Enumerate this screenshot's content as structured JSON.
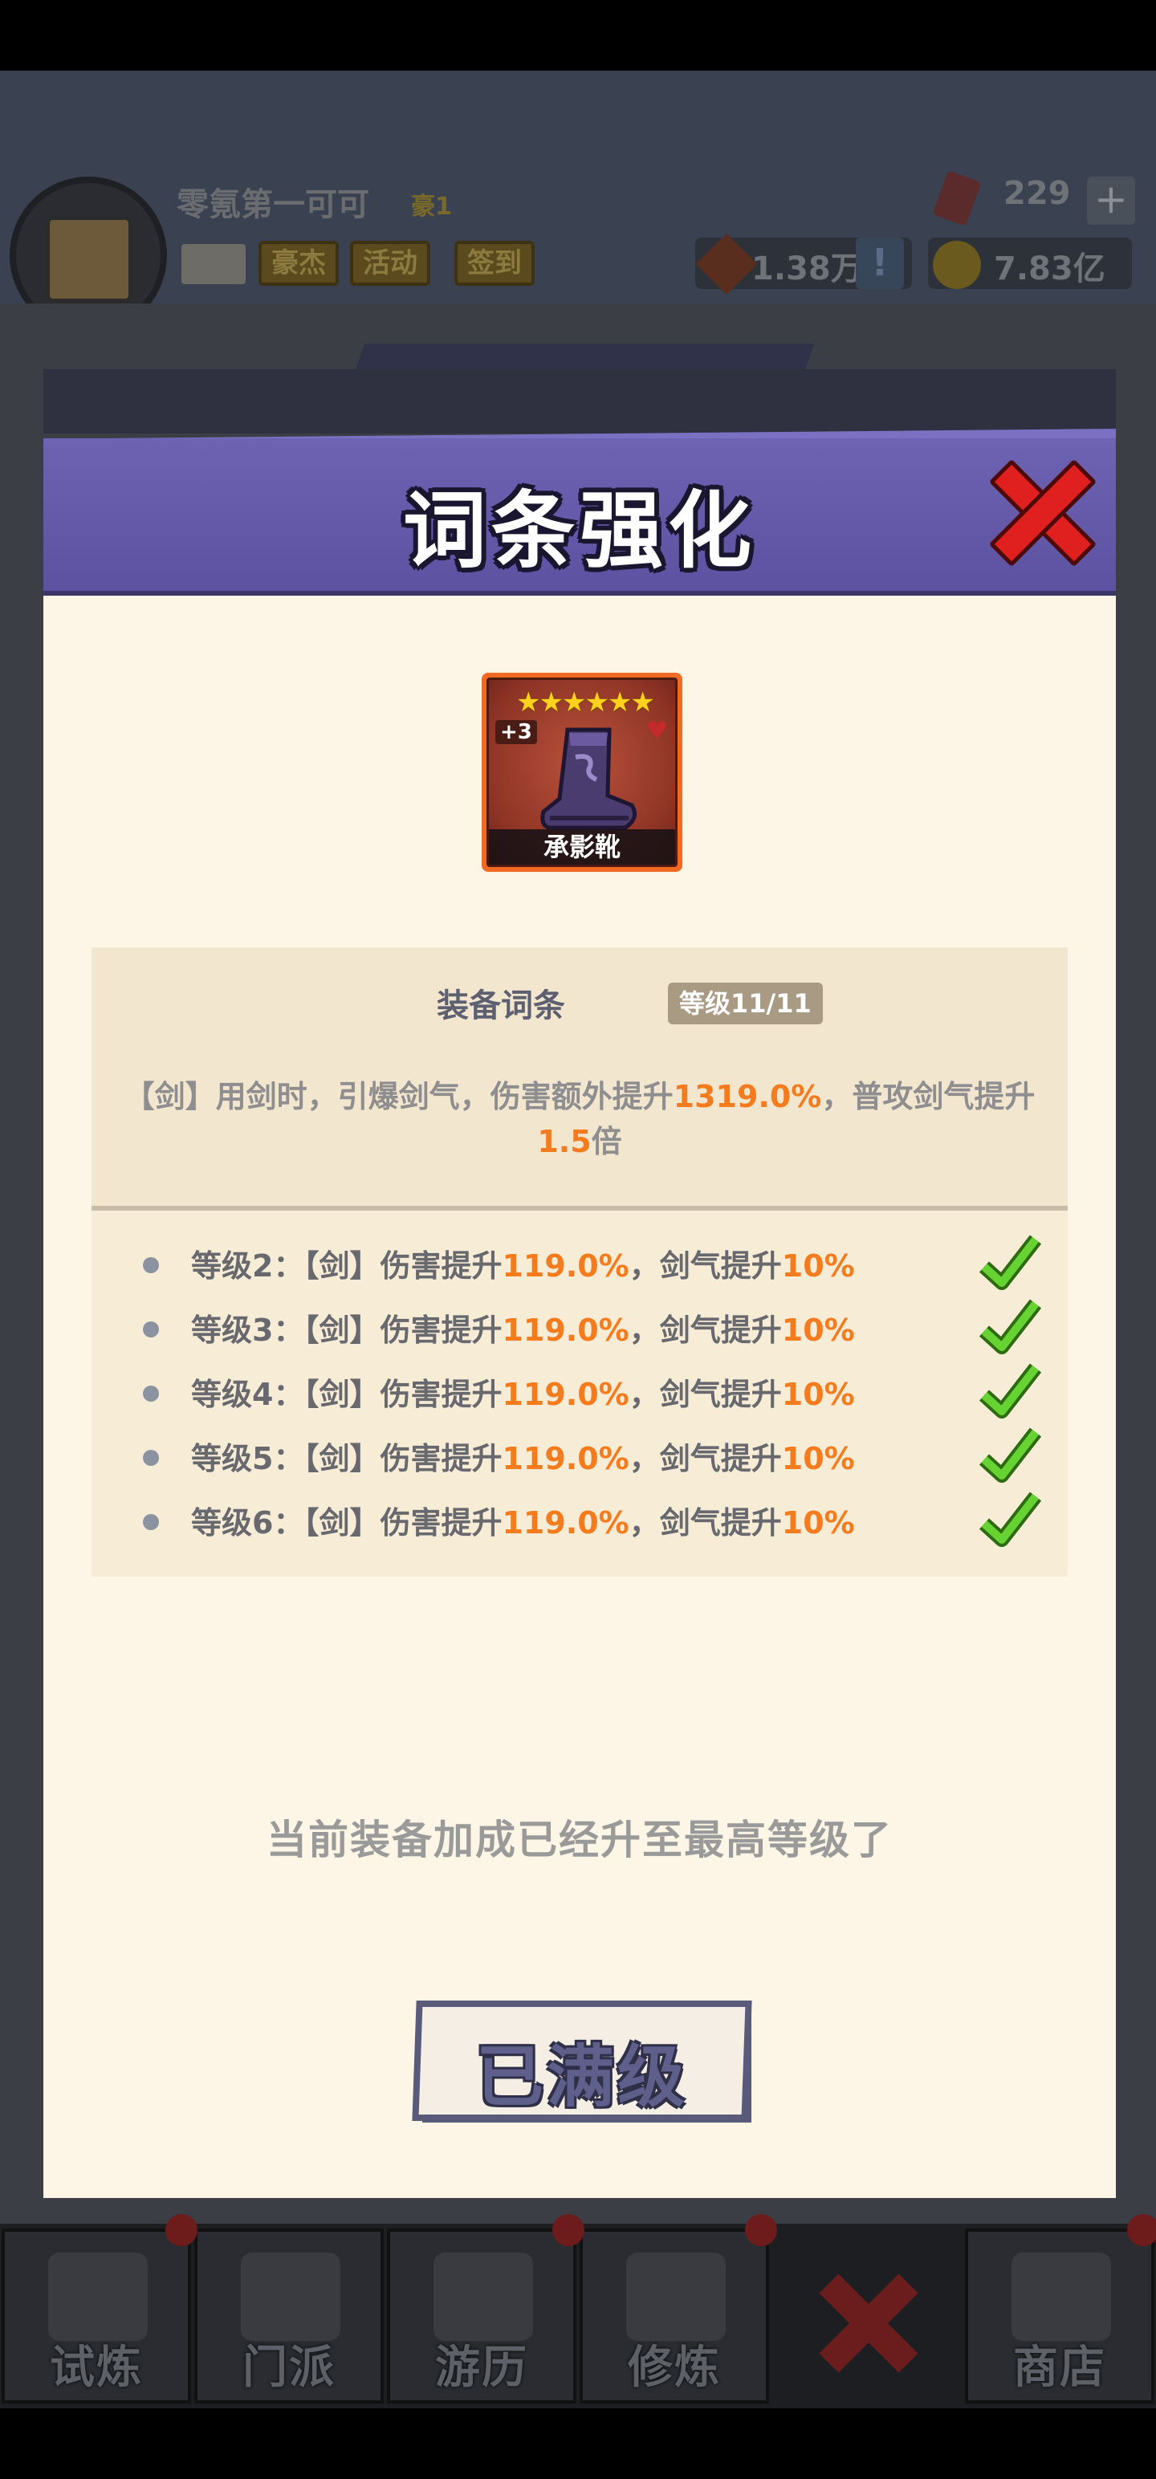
{
  "player": {
    "name": "零氪第一可可",
    "rank": "豪1",
    "chips": [
      "豪杰",
      "活动",
      "签到"
    ]
  },
  "resources": {
    "gems": "229",
    "power": "1.38万",
    "gold": "7.83亿"
  },
  "modal": {
    "title": "词条强化",
    "item": {
      "stars": "★★★★★★",
      "enhance": "+3",
      "name": "承影靴"
    },
    "affix": {
      "title": "装备词条",
      "level_badge": "等级11/11",
      "desc_part1": "【剑】用剑时，引爆剑气，伤害额外提升",
      "desc_value1": "1319.0%",
      "desc_part2": "，普攻剑气提升",
      "desc_value2": "1.5",
      "desc_part3": "倍"
    },
    "levels": [
      {
        "prefix": "等级2：【剑】伤害提升",
        "value1": "119.0%",
        "middle": "，剑气提升",
        "value2": "10%"
      },
      {
        "prefix": "等级3：【剑】伤害提升",
        "value1": "119.0%",
        "middle": "，剑气提升",
        "value2": "10%"
      },
      {
        "prefix": "等级4：【剑】伤害提升",
        "value1": "119.0%",
        "middle": "，剑气提升",
        "value2": "10%"
      },
      {
        "prefix": "等级5：【剑】伤害提升",
        "value1": "119.0%",
        "middle": "，剑气提升",
        "value2": "10%"
      },
      {
        "prefix": "等级6：【剑】伤害提升",
        "value1": "119.0%",
        "middle": "，剑气提升",
        "value2": "10%"
      }
    ],
    "max_hint": "当前装备加成已经升至最高等级了",
    "max_button": "已满级"
  },
  "nav": [
    "试炼",
    "门派",
    "游历",
    "修炼",
    "商店"
  ],
  "colors": {
    "header_purple": "#6e62b2",
    "highlight_orange": "#f47b1e",
    "close_red": "#e0201f",
    "check_green": "#5cc92f",
    "panel_bg": "#fdf6e6"
  }
}
